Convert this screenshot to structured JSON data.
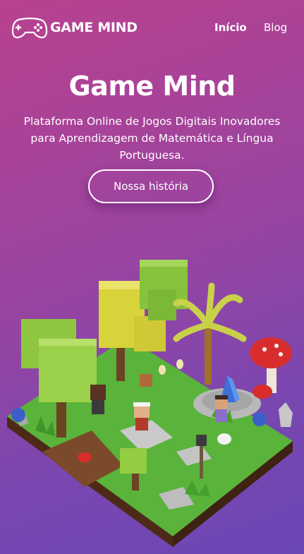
{
  "brand": {
    "name": "GAME MIND",
    "logo_icon": "gamepad-icon"
  },
  "nav": {
    "items": [
      {
        "label": "Início",
        "active": true
      },
      {
        "label": "Blog",
        "active": false
      }
    ]
  },
  "hero": {
    "title": "Game Mind",
    "subtitle": "Plataforma Online de Jogos Digitais Inovadores para Aprendizagem de Matemática e Língua Portuguesa.",
    "cta_label": "Nossa história"
  },
  "colors": {
    "gradient_start": "#b8418f",
    "gradient_end": "#6a47b5",
    "text": "#ffffff"
  }
}
